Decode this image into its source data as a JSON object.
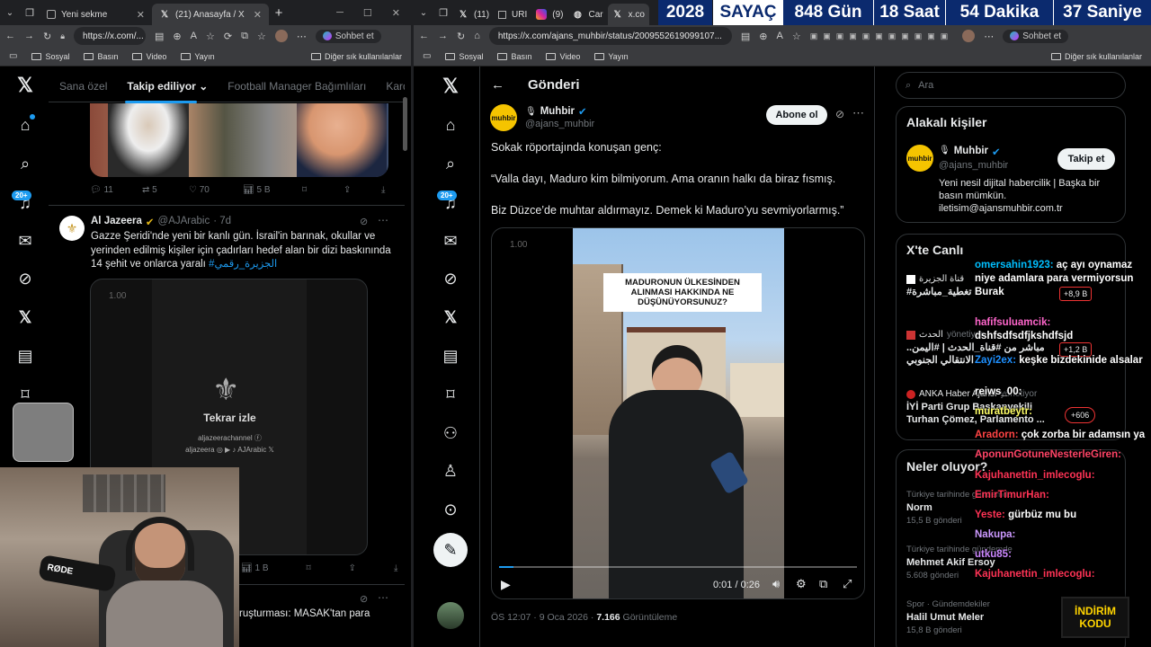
{
  "colors": {
    "accent": "#1d9bf0",
    "bg": "#000000",
    "timer_bg": "#0b2a6e",
    "verified": "#1d9bf0",
    "promo": "#ffd400"
  },
  "left": {
    "tabs": [
      {
        "label": "Yeni sekme",
        "icon": "page-icon"
      },
      {
        "label": "(21) Anasayfa / X",
        "icon": "x-logo-icon"
      }
    ],
    "url": "https://x.com/...",
    "bookmarks": [
      "Sosyal",
      "Basın",
      "Video",
      "Yayın"
    ],
    "bookmarks_other": "Diğer sık kullanılanlar",
    "chat_button": "Sohbet et",
    "feed_tabs": [
      "Sana özel",
      "Takip ediliyor",
      "Football Manager Bağımlıları",
      "Karde"
    ],
    "badge": "20+",
    "tweet1_actions": {
      "replies": "11",
      "retweets": "5",
      "likes": "70",
      "views": "5 B"
    },
    "tweet2": {
      "name": "Al Jazeera",
      "handle": "@AJArabic",
      "time": "· 7d",
      "text": "Gazze Şeridi'nde yeni bir kanlı gün. İsrail'in barınak, okullar ve yerinden edilmiş kişiler için çadırları hedef alan bir dizi baskınında 14 şehit ve onlarca yaralı",
      "hashtag": "#الجزيرة_رقمي"
    },
    "video": {
      "speed": "1.00",
      "replay": "Tekrar izle",
      "credit1": "aljazeerachannel",
      "credit2": "aljazeera",
      "credit3": "AJArabic"
    },
    "tweet2_views": "1 B",
    "tweet3_text": "ruşturması: MASAK'tan para",
    "cam_label": "RØDE"
  },
  "right": {
    "tabs": [
      "(11)",
      "URI",
      "(9)",
      "Car",
      "x.co"
    ],
    "timer": {
      "year": "2028",
      "label": "SAYAÇ",
      "days": "848 Gün",
      "hours": "18 Saat",
      "minutes": "54 Dakika",
      "seconds": "37 Saniye"
    },
    "url": "https://x.com/ajans_muhbir/status/2009552619099107...",
    "bookmarks": [
      "Sosyal",
      "Basın",
      "Video",
      "Yayın"
    ],
    "bookmarks_other": "Diğer sık kullanılanlar",
    "chat_button": "Sohbet et",
    "badge": "20+",
    "header": "Gönderi",
    "post": {
      "name": "Muhbir",
      "handle": "@ajans_muhbir",
      "subscribe": "Abone ol",
      "line1": "Sokak röportajında konuşan genç:",
      "line2": "“Valla dayı, Maduro kim bilmiyorum. Ama oranın halkı da biraz fısmış.",
      "line3": "Biz Düzce’de muhtar aldırmayız. Demek ki Maduro’yu sevmiyorlarmış.”",
      "avatar_text": "muhbir"
    },
    "video": {
      "speed": "1.00",
      "caption": "MADURONUN ÜLKESİNDEN ALINMASI HAKKINDA NE DÜŞÜNÜYORSUNUZ?",
      "time": "0:01 / 0:26",
      "progress": 0.04
    },
    "meta": {
      "time": "ÖS 12:07 · 9 Oca 2026 ·",
      "views": "7.166",
      "views_label": "Görüntüleme"
    },
    "search_placeholder": "Ara",
    "related": {
      "title": "Alakalı kişiler",
      "name": "Muhbir",
      "handle": "@ajans_muhbir",
      "follow": "Takip et",
      "bio": "Yeni nesil dijital habercilik | Başka bir basın mümkün. iletisim@ajansmuhbir.com.tr"
    },
    "live": {
      "title": "X'te Canlı",
      "items": [
        {
          "name": "قناة الجزيرة",
          "text": "#تغطية_مباشرة",
          "extra": "+8,9 B"
        },
        {
          "name": "الحدث",
          "status": "yönetiyor",
          "text": "مباشر من #قناة_الحدث | #اليمن.. الانتقالي الجنوبي",
          "extra": "+1,2 B"
        },
        {
          "name": "ANKA Haber Ajansı",
          "status": "yönetiyor",
          "text": "İYİ Parti Grup Başkanvekili Turhan Çömez, Parlamento ...",
          "extra": "+606"
        }
      ]
    },
    "trends": {
      "title": "Neler oluyor?",
      "items": [
        {
          "cat": "Türkiye tarihinde gündemde",
          "name": "Norm",
          "count": "15,5 B gönderi"
        },
        {
          "cat": "Türkiye tarihinde gündemde",
          "name": "Mehmet Akif Ersoy",
          "count": "5.608 gönderi"
        },
        {
          "cat": "Spor · Gündemdekiler",
          "name": "Halil Umut Meler",
          "count": "15,8 B gönderi"
        }
      ]
    }
  },
  "chat": [
    {
      "user": "omersahin1923:",
      "msg": "aç ayı oynamaz niye adamlara para vermiyorsun Burak",
      "color": "#00bfff"
    },
    {
      "user": "hafifsuluamcik:",
      "msg": "dshfsdfsdfjkshdfsjd",
      "color": "#ff66cc"
    },
    {
      "user": "Zayi2ex:",
      "msg": "keşke bizdekinide alsalar",
      "color": "#1e90ff"
    },
    {
      "user": "reiws_00:",
      "msg": "",
      "color": "#ffffff"
    },
    {
      "user": "muratbeytr:",
      "msg": "",
      "color": "#ffff66"
    },
    {
      "user": "Aradorn:",
      "msg": "çok zorba bir adamsın ya",
      "color": "#ff4444"
    },
    {
      "user": "AponunGotuneNesterleGiren:",
      "msg": "",
      "color": "#ff4466"
    },
    {
      "user": "Kajuhanettin_imlecoglu:",
      "msg": "",
      "color": "#ff3355"
    },
    {
      "user": "EmirTimurHan:",
      "msg": "",
      "color": "#ff3355"
    },
    {
      "user": "Yeste:",
      "msg": "gürbüz mu bu",
      "color": "#ff3355"
    },
    {
      "user": "Nakupa:",
      "msg": "",
      "color": "#cc99ff"
    },
    {
      "user": "utku85:",
      "msg": "",
      "color": "#cc88ff"
    },
    {
      "user": "Kajuhanettin_imlecoglu:",
      "msg": "",
      "color": "#ff3355"
    }
  ],
  "promo": {
    "line1": "İNDİRİM",
    "line2": "KODU"
  }
}
